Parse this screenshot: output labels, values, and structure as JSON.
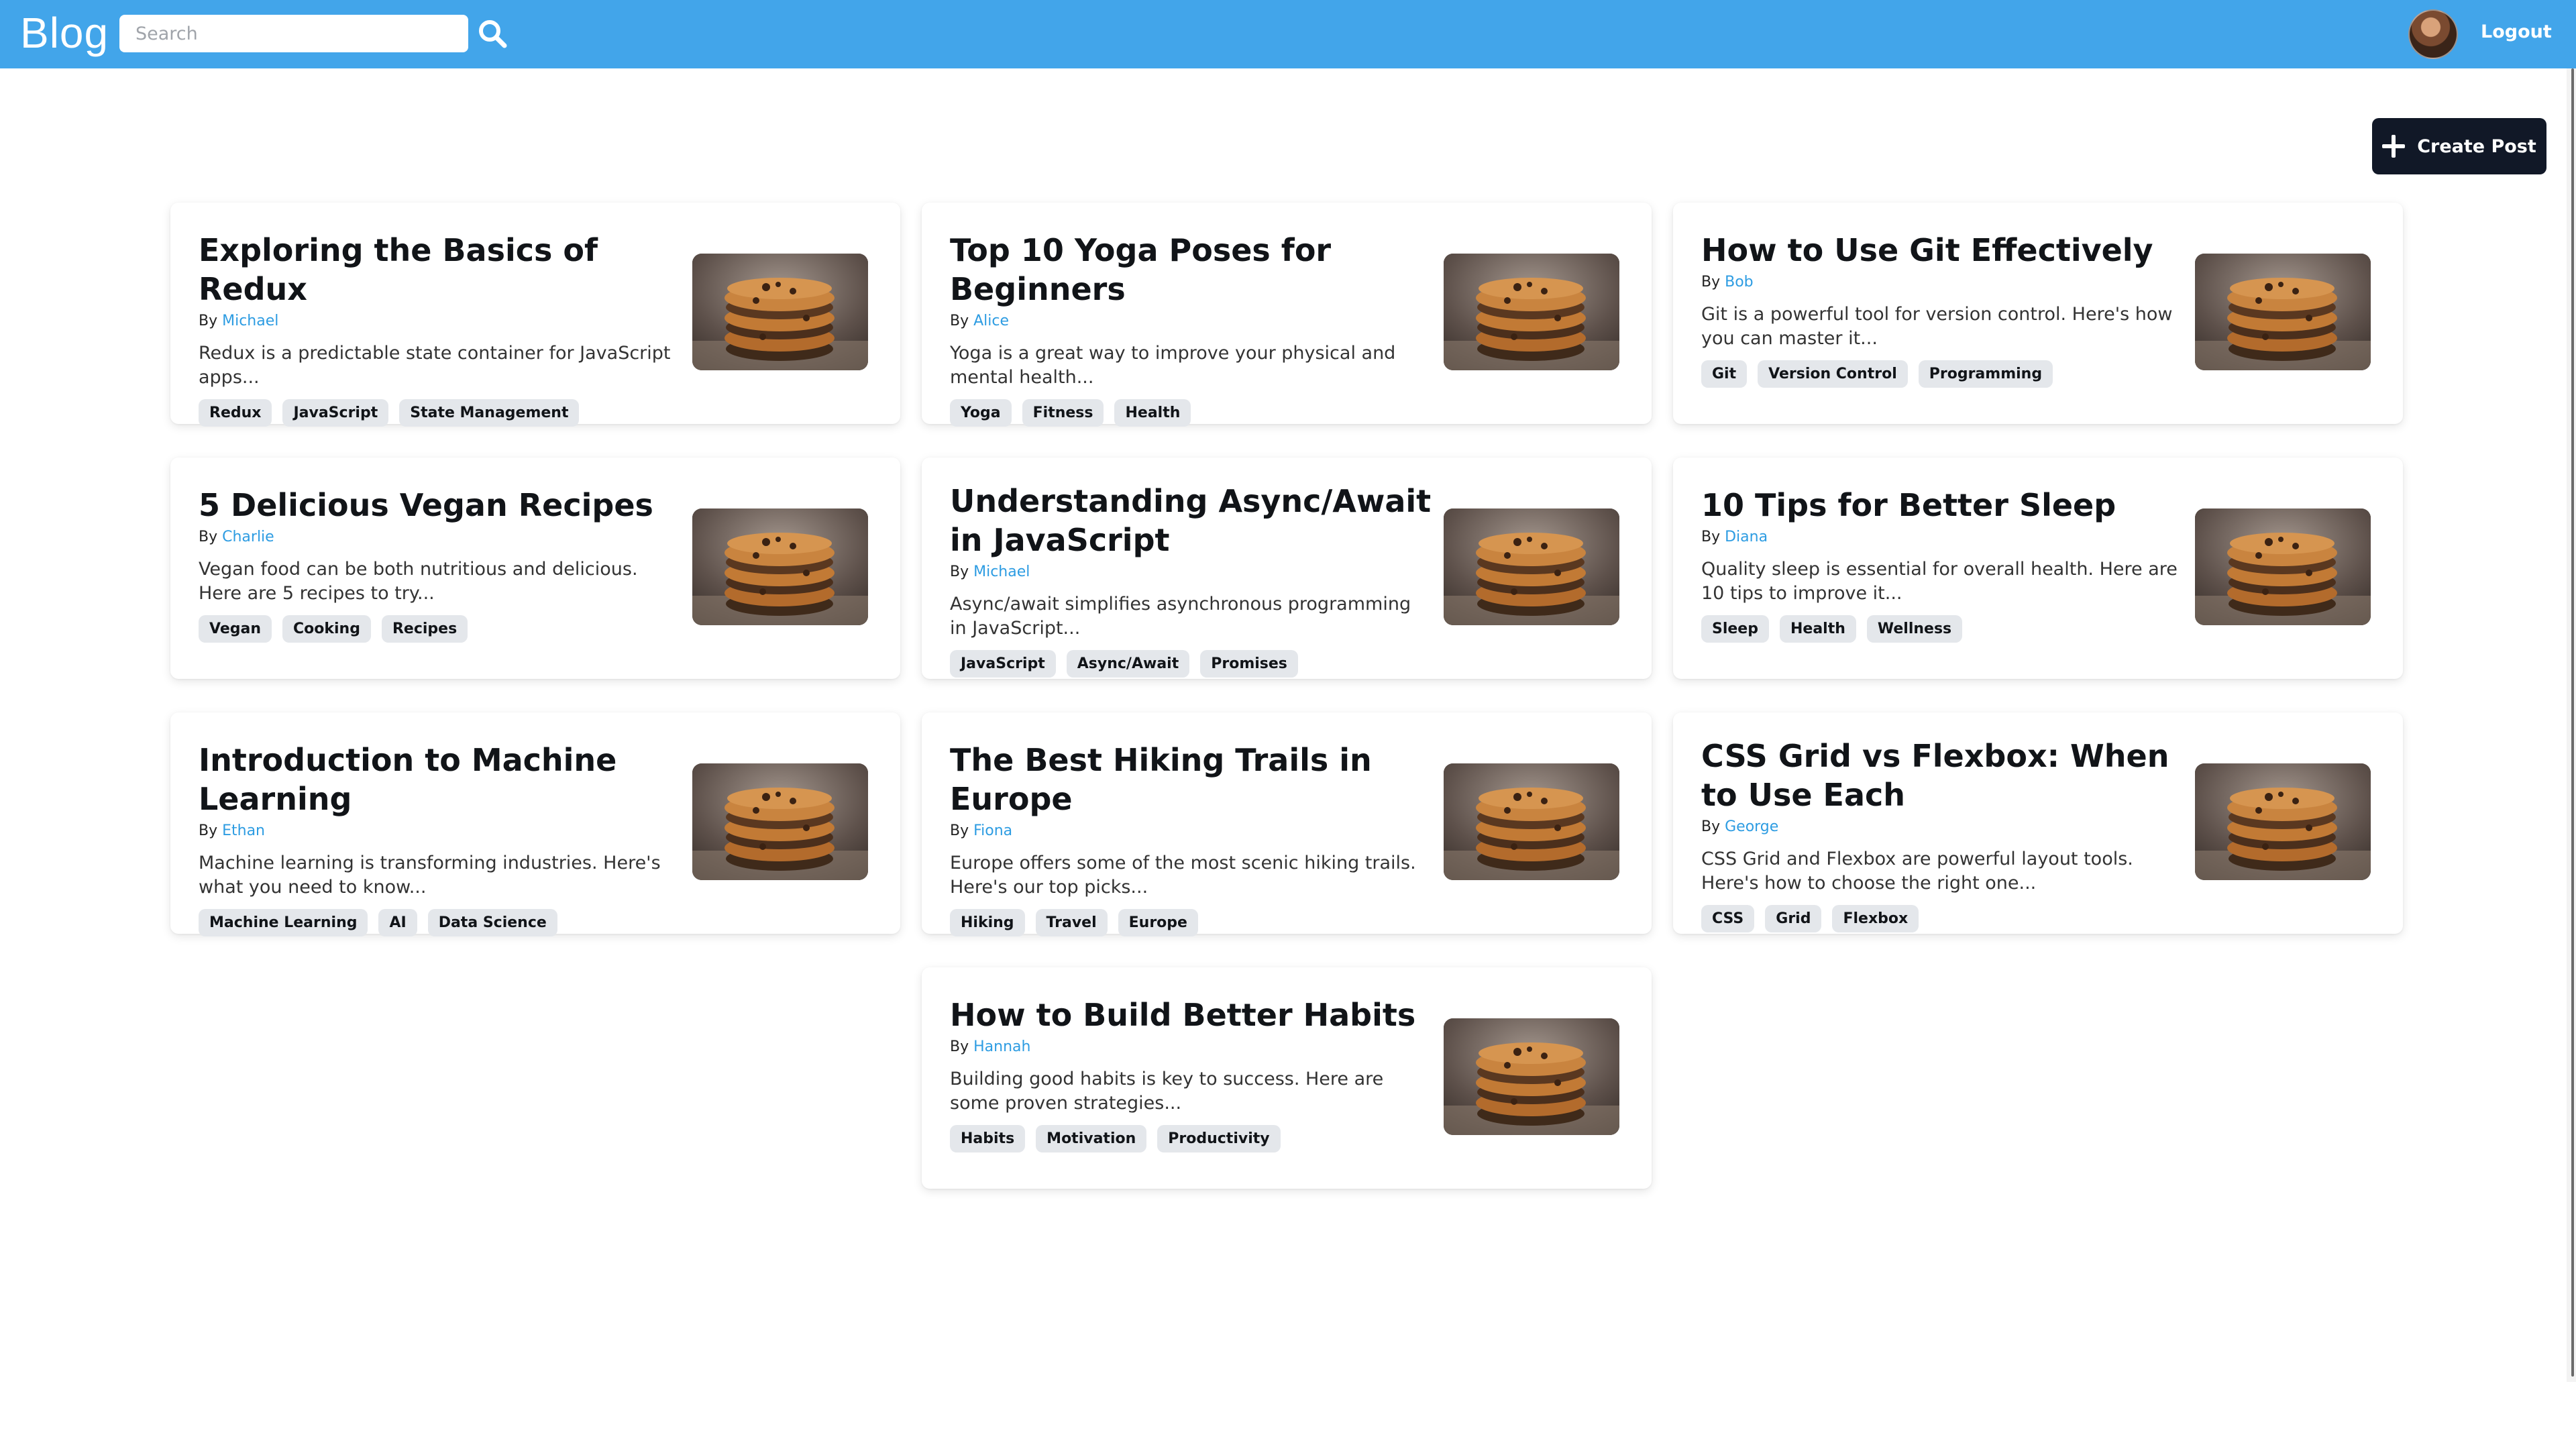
{
  "header": {
    "brand": "Blog",
    "search_placeholder": "Search",
    "logout_label": "Logout"
  },
  "actions": {
    "create_post_label": "Create Post"
  },
  "posts": [
    {
      "title": "Exploring the Basics of Redux",
      "by": "By",
      "author": "Michael",
      "excerpt": "Redux is a predictable state container for JavaScript apps...",
      "tags": [
        "Redux",
        "JavaScript",
        "State Management"
      ]
    },
    {
      "title": "Top 10 Yoga Poses for Beginners",
      "by": "By",
      "author": "Alice",
      "excerpt": "Yoga is a great way to improve your physical and mental health...",
      "tags": [
        "Yoga",
        "Fitness",
        "Health"
      ]
    },
    {
      "title": "How to Use Git Effectively",
      "by": "By",
      "author": "Bob",
      "excerpt": "Git is a powerful tool for version control. Here's how you can master it...",
      "tags": [
        "Git",
        "Version Control",
        "Programming"
      ]
    },
    {
      "title": "5 Delicious Vegan Recipes",
      "by": "By",
      "author": "Charlie",
      "excerpt": "Vegan food can be both nutritious and delicious. Here are 5 recipes to try...",
      "tags": [
        "Vegan",
        "Cooking",
        "Recipes"
      ]
    },
    {
      "title": "Understanding Async/Await in JavaScript",
      "by": "By",
      "author": "Michael",
      "excerpt": "Async/await simplifies asynchronous programming in JavaScript...",
      "tags": [
        "JavaScript",
        "Async/Await",
        "Promises"
      ]
    },
    {
      "title": "10 Tips for Better Sleep",
      "by": "By",
      "author": "Diana",
      "excerpt": "Quality sleep is essential for overall health. Here are 10 tips to improve it...",
      "tags": [
        "Sleep",
        "Health",
        "Wellness"
      ]
    },
    {
      "title": "Introduction to Machine Learning",
      "by": "By",
      "author": "Ethan",
      "excerpt": "Machine learning is transforming industries. Here's what you need to know...",
      "tags": [
        "Machine Learning",
        "AI",
        "Data Science"
      ]
    },
    {
      "title": "The Best Hiking Trails in Europe",
      "by": "By",
      "author": "Fiona",
      "excerpt": "Europe offers some of the most scenic hiking trails. Here's our top picks...",
      "tags": [
        "Hiking",
        "Travel",
        "Europe"
      ]
    },
    {
      "title": "CSS Grid vs Flexbox: When to Use Each",
      "by": "By",
      "author": "George",
      "excerpt": "CSS Grid and Flexbox are powerful layout tools. Here's how to choose the right one...",
      "tags": [
        "CSS",
        "Grid",
        "Flexbox"
      ]
    },
    {
      "title": "How to Build Better Habits",
      "by": "By",
      "author": "Hannah",
      "excerpt": "Building good habits is key to success. Here are some proven strategies...",
      "tags": [
        "Habits",
        "Motivation",
        "Productivity"
      ]
    }
  ]
}
